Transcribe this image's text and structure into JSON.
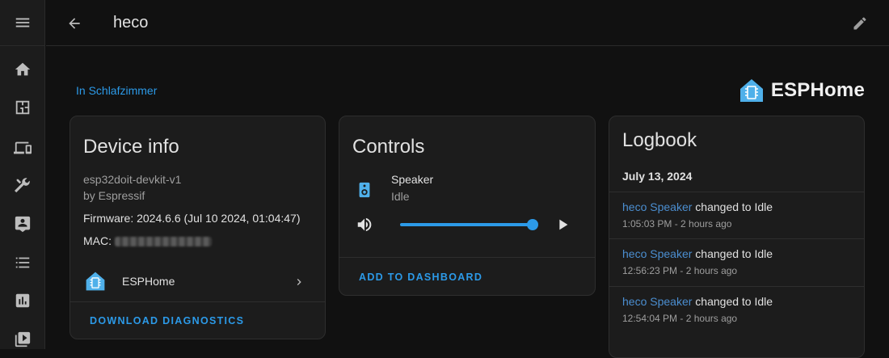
{
  "topbar": {
    "title": "heco"
  },
  "area_link": "In Schlafzimmer",
  "brand": {
    "name": "ESPHome",
    "color": "#4fb0ea"
  },
  "sidebar": {
    "items": [
      {
        "icon": "home-icon"
      },
      {
        "icon": "floorplan-icon"
      },
      {
        "icon": "devices-icon"
      },
      {
        "icon": "tools-icon"
      },
      {
        "icon": "contact-card-icon"
      },
      {
        "icon": "list-icon"
      },
      {
        "icon": "chart-icon"
      },
      {
        "icon": "media-icon"
      }
    ]
  },
  "device_info": {
    "title": "Device info",
    "model": "esp32doit-devkit-v1",
    "manufacturer": "by Espressif",
    "firmware": "Firmware: 2024.6.6 (Jul 10 2024, 01:04:47)",
    "mac_label": "MAC:",
    "integration": "ESPHome",
    "action": "DOWNLOAD DIAGNOSTICS"
  },
  "controls": {
    "title": "Controls",
    "entity_name": "Speaker",
    "entity_state": "Idle",
    "volume_level": 0.99,
    "action": "ADD TO DASHBOARD"
  },
  "logbook": {
    "title": "Logbook",
    "date": "July 13, 2024",
    "entries": [
      {
        "entity": "heco Speaker",
        "message": " changed to Idle",
        "time": "1:05:03 PM - 2 hours ago"
      },
      {
        "entity": "heco Speaker",
        "message": " changed to Idle",
        "time": "12:56:23 PM - 2 hours ago"
      },
      {
        "entity": "heco Speaker",
        "message": " changed to Idle",
        "time": "12:54:04 PM - 2 hours ago"
      }
    ]
  },
  "colors": {
    "accent": "#2c9ae8",
    "background": "#111111",
    "card": "#1c1c1c"
  }
}
